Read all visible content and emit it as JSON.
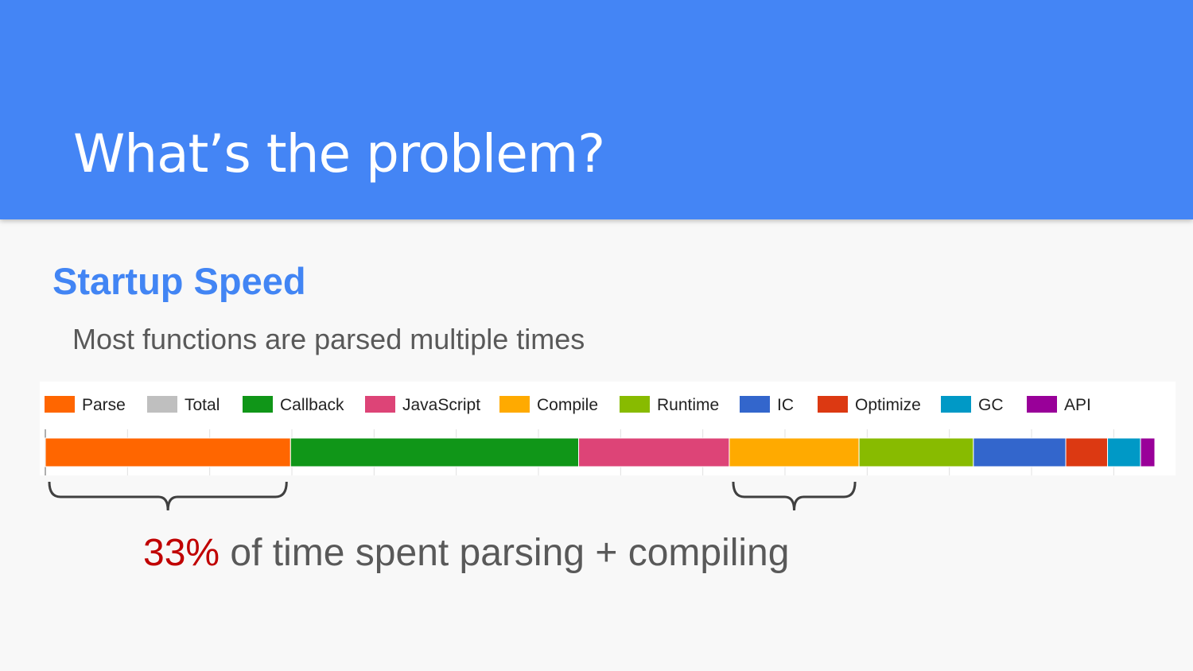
{
  "slide": {
    "title": "What’s the problem?",
    "subtitle": "Startup Speed",
    "body": "Most functions are parsed multiple times",
    "callout_percent": "33%",
    "callout_text": " of time spent parsing + compiling"
  },
  "chart_data": {
    "type": "bar",
    "orientation": "horizontal-stacked",
    "categories": [
      "Parse",
      "Total",
      "Callback",
      "JavaScript",
      "Compile",
      "Runtime",
      "IC",
      "Optimize",
      "GC",
      "API"
    ],
    "series": [
      {
        "name": "Parse",
        "value": 22.3,
        "color": "#ff6600"
      },
      {
        "name": "Total",
        "value": 0,
        "color": "#bfbfbf"
      },
      {
        "name": "Callback",
        "value": 26.2,
        "color": "#109618"
      },
      {
        "name": "JavaScript",
        "value": 13.7,
        "color": "#dd4477"
      },
      {
        "name": "Compile",
        "value": 11.8,
        "color": "#ffaa00"
      },
      {
        "name": "Runtime",
        "value": 10.4,
        "color": "#88bb00"
      },
      {
        "name": "IC",
        "value": 8.4,
        "color": "#3366cc"
      },
      {
        "name": "Optimize",
        "value": 3.8,
        "color": "#dc3912"
      },
      {
        "name": "GC",
        "value": 3.0,
        "color": "#0099c6"
      },
      {
        "name": "API",
        "value": 1.3,
        "color": "#990099"
      }
    ],
    "legend_position": "top",
    "grid": true,
    "braces": [
      {
        "from": "Parse",
        "to": "Parse"
      },
      {
        "from": "Compile",
        "to": "Compile"
      }
    ]
  }
}
